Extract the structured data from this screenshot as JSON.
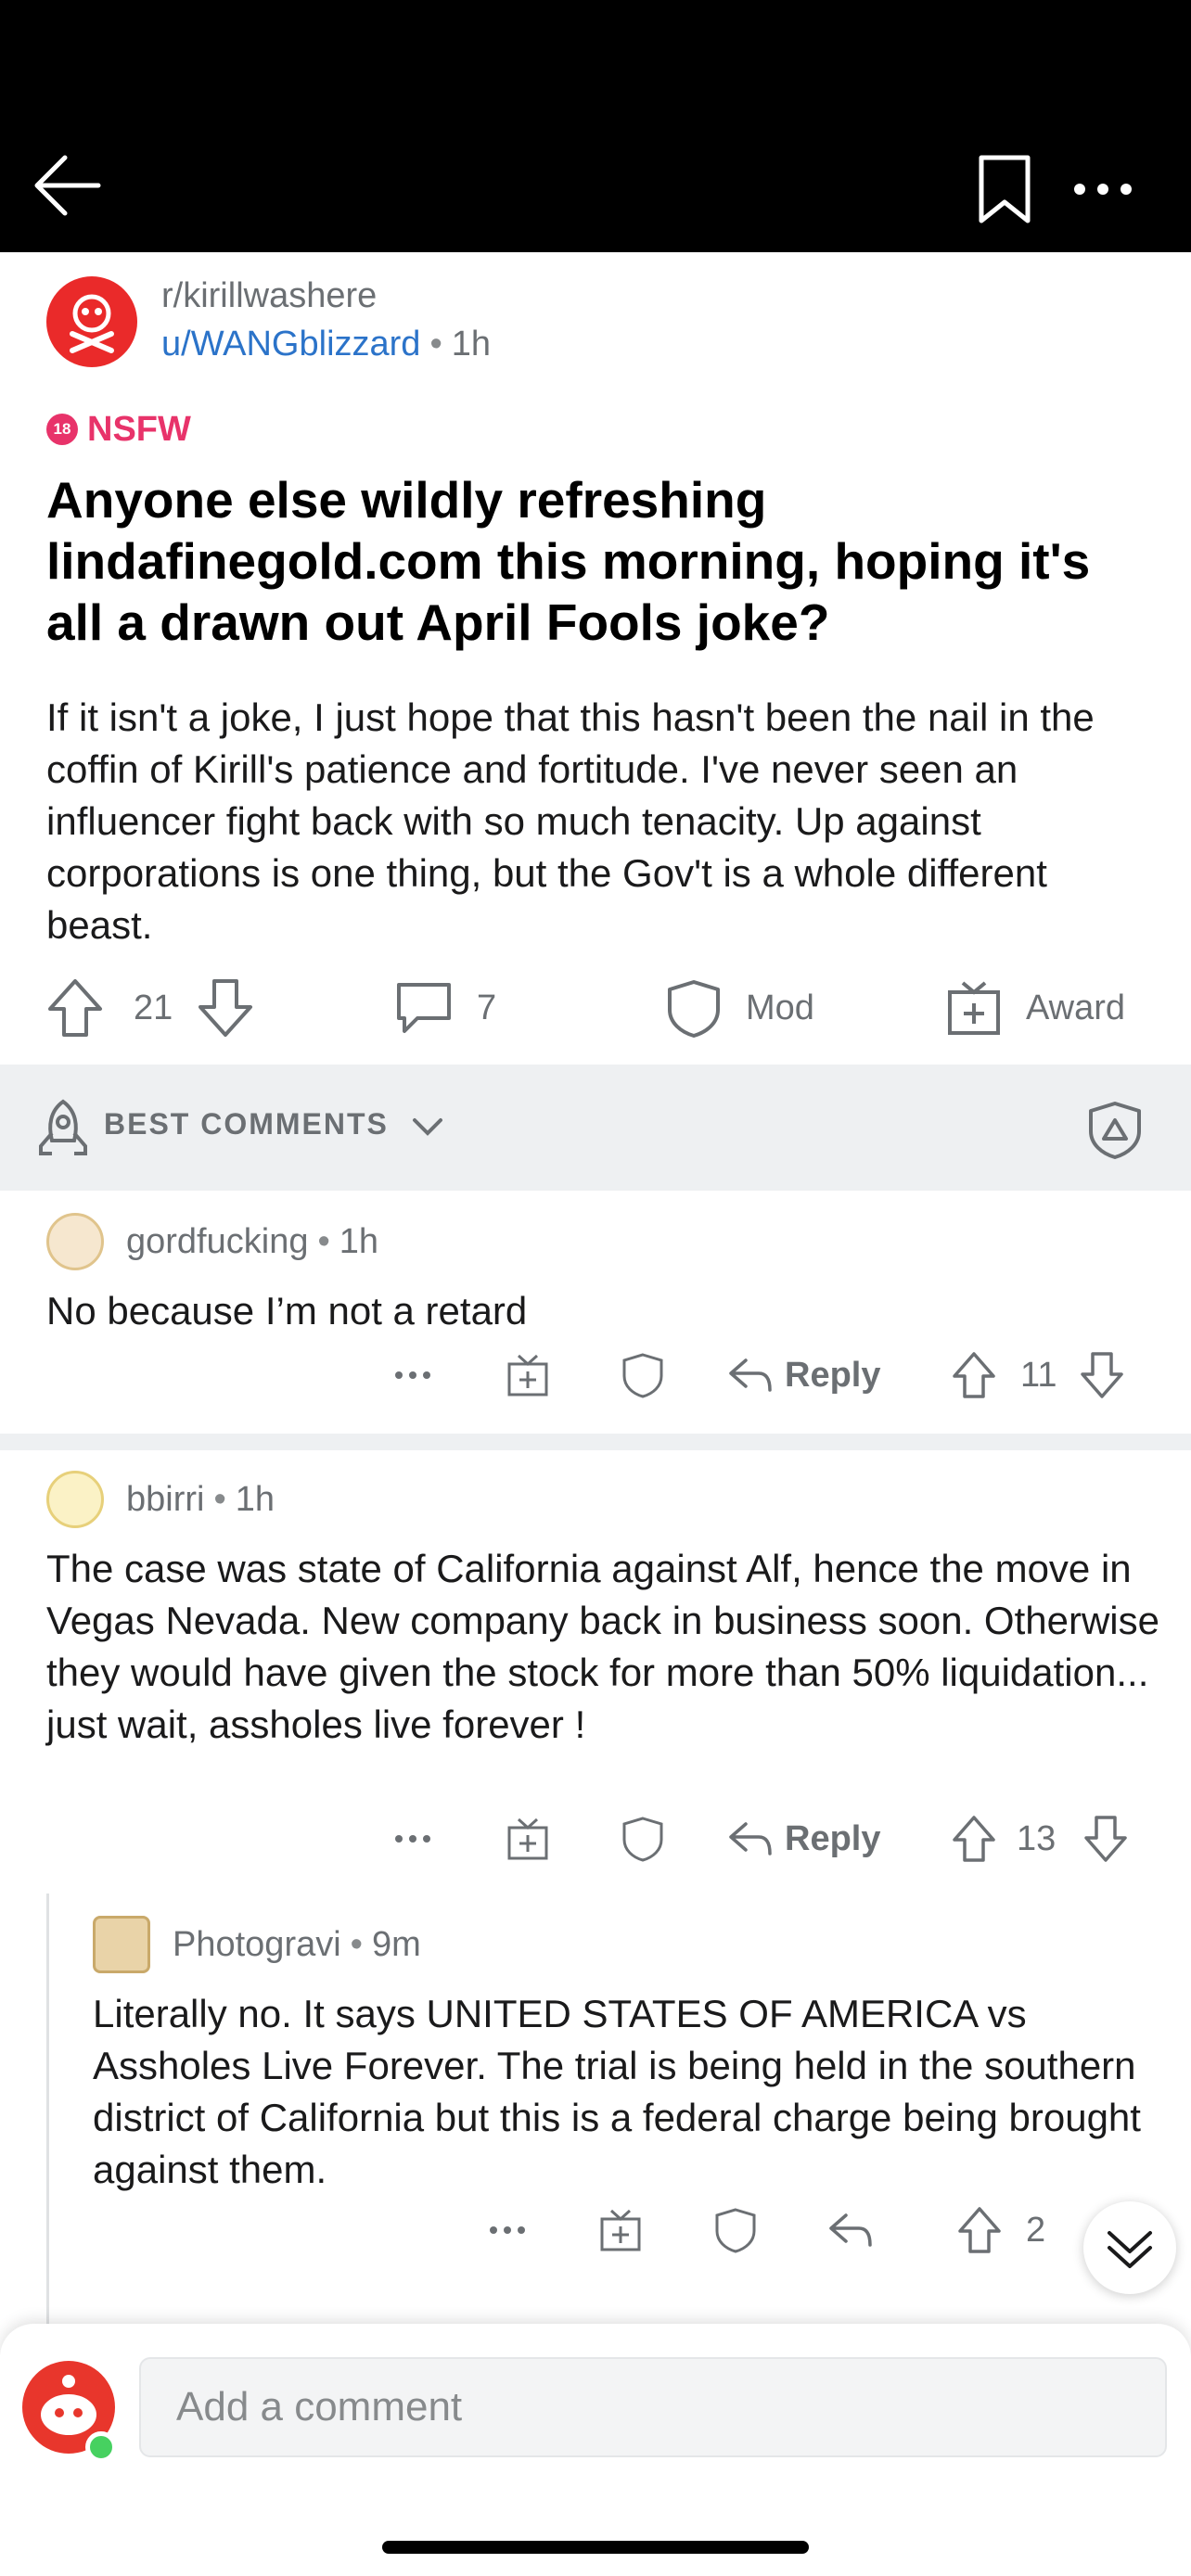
{
  "post": {
    "subreddit": "r/kirillwashere",
    "author": "u/WANGblizzard",
    "separator": "•",
    "age": "1h",
    "nsfw_badge": "18",
    "nsfw_label": "NSFW",
    "title": "Anyone else wildly refreshing lindafinegold.com this morning, hoping it's all a drawn out April Fools joke?",
    "body": "If it isn't a joke, I just hope that this hasn't been the nail in the coffin of Kirill's patience and fortitude. I've never seen an influencer fight back with so much tenacity. Up against corporations is one thing, but the Gov't is a whole different beast.",
    "upvotes": "21",
    "comments": "7",
    "mod_label": "Mod",
    "award_label": "Award"
  },
  "sort": {
    "label": "BEST COMMENTS"
  },
  "comments": [
    {
      "user": "gordfucking",
      "age": "1h",
      "body": "No because I’m not a retard",
      "more": "•••",
      "reply_label": "Reply",
      "votes": "11"
    },
    {
      "user": "bbirri",
      "age": "1h",
      "body": "The case was state of California against Alf, hence the move in Vegas Nevada. New company back in business soon. Otherwise they would have given the stock for more than 50% liquidation... just wait, assholes live forever !",
      "more": "•••",
      "reply_label": "Reply",
      "votes": "13"
    },
    {
      "user": "Photogravi",
      "age": "9m",
      "body": "Literally no. It says UNITED STATES OF AMERICA vs Assholes Live Forever. The trial is being held in the southern district of California but this is a federal charge being brought against them.",
      "more": "•••",
      "votes": "2"
    }
  ],
  "composer": {
    "placeholder": "Add a comment"
  },
  "colors": {
    "accent": "#2b73c9",
    "nsfw": "#e8336a",
    "brand": "#ff4500"
  }
}
